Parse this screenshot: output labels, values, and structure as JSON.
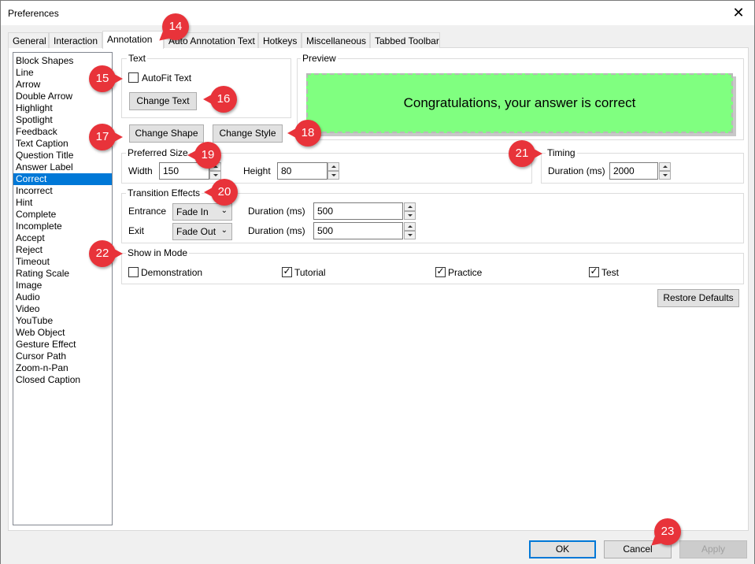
{
  "window": {
    "title": "Preferences",
    "close_glyph": "✕"
  },
  "tabs": [
    {
      "label": "General"
    },
    {
      "label": "Interaction"
    },
    {
      "label": "Annotation"
    },
    {
      "label": "Auto Annotation Text"
    },
    {
      "label": "Hotkeys"
    },
    {
      "label": "Miscellaneous"
    },
    {
      "label": "Tabbed Toolbar"
    }
  ],
  "active_tab": "Annotation",
  "annotation_types": [
    "Block Shapes",
    "Line",
    "Arrow",
    "Double Arrow",
    "Highlight",
    "Spotlight",
    "Feedback",
    "Text Caption",
    "Question Title",
    "Answer Label",
    "Correct",
    "Incorrect",
    "Hint",
    "Complete",
    "Incomplete",
    "Accept",
    "Reject",
    "Timeout",
    "Rating Scale",
    "Image",
    "Audio",
    "Video",
    "YouTube",
    "Web Object",
    "Gesture Effect",
    "Cursor Path",
    "Zoom-n-Pan",
    "Closed Caption"
  ],
  "selected_type": "Correct",
  "text_group": {
    "label": "Text",
    "autofit_label": "AutoFit Text",
    "autofit_checked": false,
    "change_text_label": "Change Text"
  },
  "preview": {
    "label": "Preview",
    "text": "Congratulations, your answer is correct",
    "fill_color": "#80ff80"
  },
  "shape_buttons": {
    "change_shape_label": "Change Shape",
    "change_style_label": "Change Style"
  },
  "preferred_size": {
    "label": "Preferred Size",
    "width_label": "Width",
    "width_value": "150",
    "height_label": "Height",
    "height_value": "80"
  },
  "timing": {
    "label": "Timing",
    "duration_label": "Duration (ms)",
    "duration_value": "2000"
  },
  "transition": {
    "label": "Transition Effects",
    "entrance_label": "Entrance",
    "entrance_value": "Fade In",
    "entrance_duration_label": "Duration (ms)",
    "entrance_duration_value": "500",
    "exit_label": "Exit",
    "exit_value": "Fade Out",
    "exit_duration_label": "Duration (ms)",
    "exit_duration_value": "500"
  },
  "show_in_mode": {
    "label": "Show in Mode",
    "modes": [
      {
        "label": "Demonstration",
        "checked": false
      },
      {
        "label": "Tutorial",
        "checked": true
      },
      {
        "label": "Practice",
        "checked": true
      },
      {
        "label": "Test",
        "checked": true
      }
    ]
  },
  "restore_defaults_label": "Restore Defaults",
  "footer": {
    "ok_label": "OK",
    "cancel_label": "Cancel",
    "apply_label": "Apply"
  },
  "callouts": [
    "14",
    "15",
    "16",
    "17",
    "18",
    "19",
    "20",
    "21",
    "22",
    "23"
  ],
  "colors": {
    "selection": "#0078d7",
    "callout": "#e8333a"
  }
}
